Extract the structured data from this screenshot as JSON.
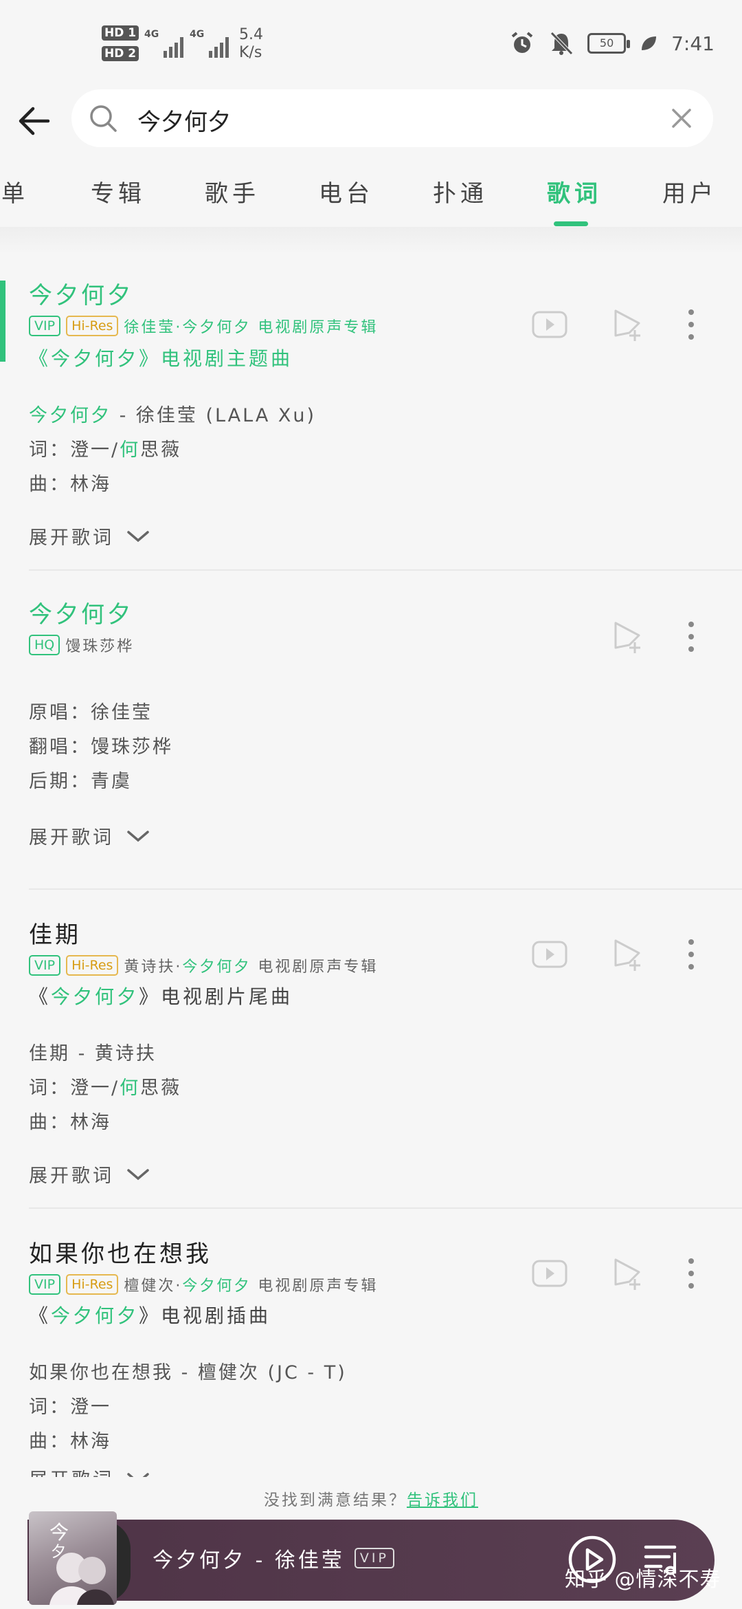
{
  "status": {
    "hd1": "HD 1",
    "hd2": "HD 2",
    "net1": "4G",
    "net2": "4G",
    "speed_value": "5.4",
    "speed_unit": "K/s",
    "battery": "50",
    "time": "7:41"
  },
  "search": {
    "query": "今夕何夕"
  },
  "tabs": [
    {
      "label": "单"
    },
    {
      "label": "专辑"
    },
    {
      "label": "歌手"
    },
    {
      "label": "电台"
    },
    {
      "label": "扑通"
    },
    {
      "label": "歌词",
      "active": true
    },
    {
      "label": "用户"
    }
  ],
  "results": [
    {
      "title": "今夕何夕",
      "tags": [
        "VIP",
        "Hi-Res"
      ],
      "meta_artist": "徐佳莹·",
      "meta_album": "今夕何夕 电视剧原声专辑",
      "subtitle": "《今夕何夕》电视剧主题曲",
      "lines": [
        "今夕何夕 - 徐佳莹 (LALA Xu)",
        "词：澄一/何思薇",
        "曲：林海"
      ],
      "expand": "展开歌词"
    },
    {
      "title": "今夕何夕",
      "tags": [
        "HQ"
      ],
      "meta_artist": "馒珠莎桦",
      "lines": [
        "原唱：徐佳莹",
        "翻唱：馒珠莎桦",
        "后期：青虞"
      ],
      "expand": "展开歌词"
    },
    {
      "title": "佳期",
      "tags": [
        "VIP",
        "Hi-Res"
      ],
      "meta_artist": "黄诗扶·",
      "meta_album_hl": "今夕何夕",
      "meta_album_rest": " 电视剧原声专辑",
      "subtitle_open": "《",
      "subtitle_hl": "今夕何夕",
      "subtitle_close": "》电视剧片尾曲",
      "lines": [
        "佳期 - 黄诗扶",
        "词：澄一/何思薇",
        "曲：林海"
      ],
      "expand": "展开歌词"
    },
    {
      "title": "如果你也在想我",
      "tags": [
        "VIP",
        "Hi-Res"
      ],
      "meta_artist": "檀健次·",
      "meta_album_hl": "今夕何夕",
      "meta_album_rest": " 电视剧原声专辑",
      "subtitle_open": "《",
      "subtitle_hl": "今夕何夕",
      "subtitle_close": "》电视剧插曲",
      "lines": [
        "如果你也在想我 - 檀健次 (JC - T)",
        "词：澄一",
        "曲：林海"
      ],
      "expand": "展开歌词"
    }
  ],
  "footer": {
    "prompt": "没找到满意结果？",
    "link": "告诉我们"
  },
  "player": {
    "title": "今夕何夕 - 徐佳莹",
    "tag": "VIP",
    "watermark": "知乎 @情深不寿"
  },
  "colors": {
    "accent": "#31c27c",
    "hires": "#d79c14",
    "player_bg": "#4e3346"
  }
}
